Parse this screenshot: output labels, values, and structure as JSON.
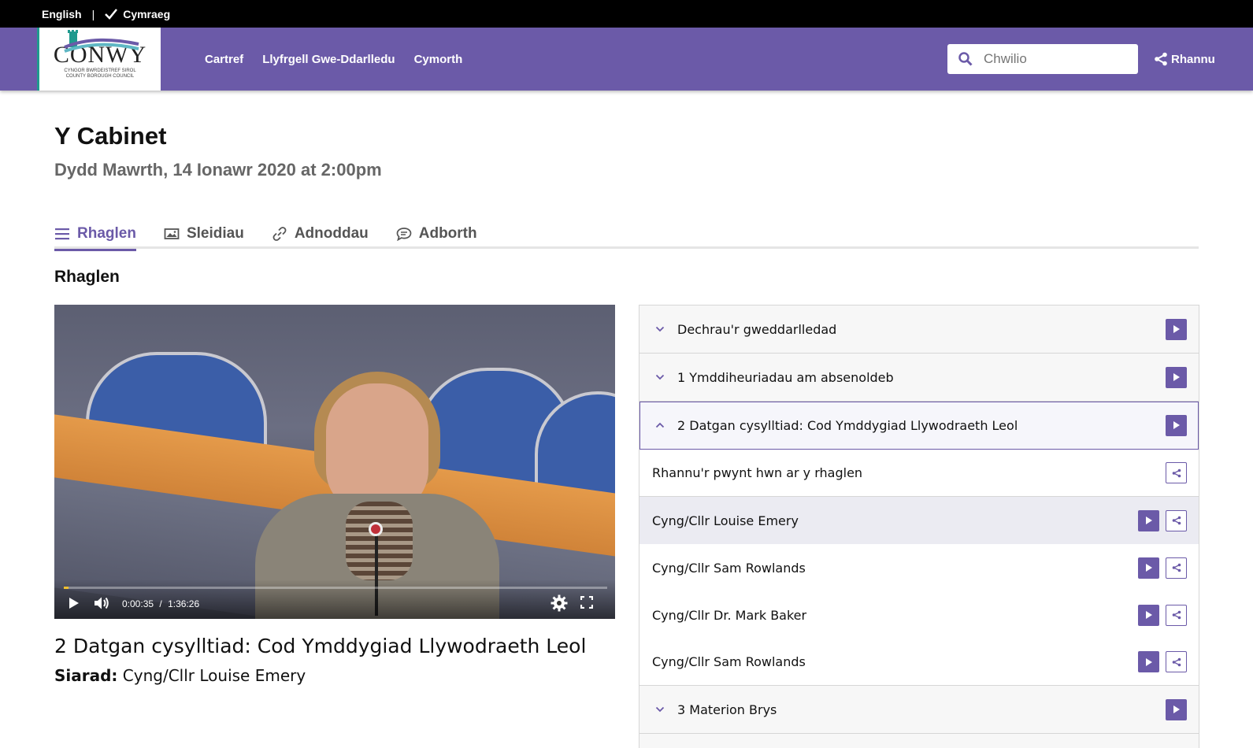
{
  "language_bar": {
    "english": "English",
    "separator": "|",
    "cymraeg": "Cymraeg"
  },
  "header": {
    "logo_text": "CONWY",
    "logo_sub_1": "CYNGOR BWRDEISTREF SIROL",
    "logo_sub_2": "COUNTY BOROUGH COUNCIL",
    "nav": [
      "Cartref",
      "Llyfrgell Gwe-Ddarlledu",
      "Cymorth"
    ],
    "search_placeholder": "Chwilio",
    "share_label": "Rhannu"
  },
  "meeting": {
    "title": "Y Cabinet",
    "date": "Dydd Mawrth, 14 Ionawr 2020 at 2:00pm"
  },
  "tabs": [
    {
      "label": "Rhaglen",
      "icon": "list-icon",
      "active": true
    },
    {
      "label": "Sleidiau",
      "icon": "image-icon",
      "active": false
    },
    {
      "label": "Adnoddau",
      "icon": "link-icon",
      "active": false
    },
    {
      "label": "Adborth",
      "icon": "comment-icon",
      "active": false
    }
  ],
  "section_heading": "Rhaglen",
  "player": {
    "current_time": "0:00:35",
    "time_separator": "/",
    "duration": "1:36:26",
    "progress_fraction": 0.0061
  },
  "now_playing": {
    "item_title": "2 Datgan cysylltiad: Cod Ymddygiad Llywodraeth Leol",
    "speaker_label": "Siarad:",
    "speaker_name": "Cyng/Cllr Louise Emery"
  },
  "agenda": {
    "item_1": "Dechrau'r gweddarlledad",
    "item_2": "1 Ymddiheuriadau am absenoldeb",
    "item_3": "2 Datgan cysylltiad: Cod Ymddygiad Llywodraeth Leol",
    "share_point": "Rhannu'r pwynt hwn ar y rhaglen",
    "speakers": [
      "Cyng/Cllr Louise Emery",
      "Cyng/Cllr Sam Rowlands",
      "Cyng/Cllr Dr. Mark Baker",
      "Cyng/Cllr Sam Rowlands"
    ],
    "item_4": "3 Materion Brys"
  },
  "colors": {
    "brand_purple": "#6b5aa8",
    "accent_teal": "#1f9a8e",
    "progress_yellow": "#f0c030"
  }
}
